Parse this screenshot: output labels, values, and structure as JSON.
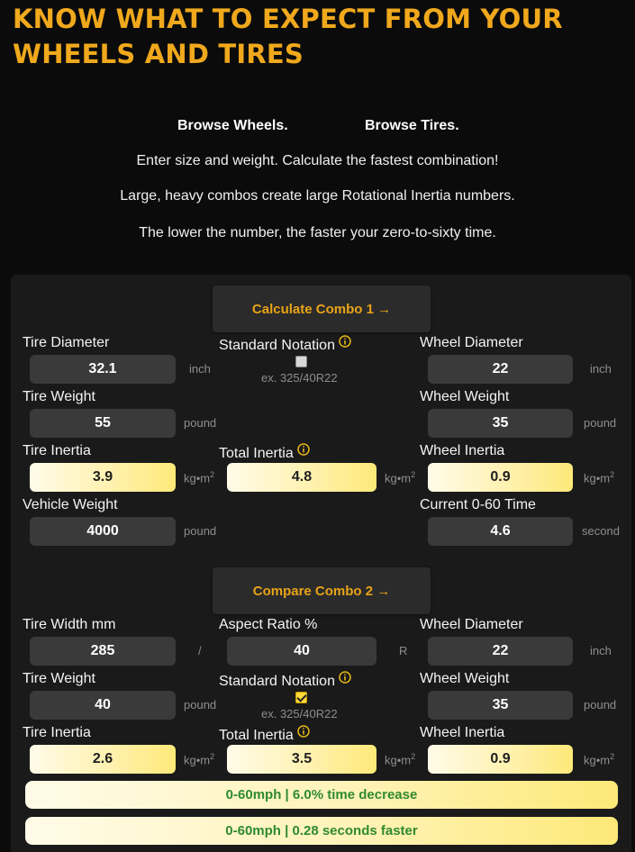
{
  "header": {
    "title_line1": "KNOW WHAT TO EXPECT FROM YOUR",
    "title_line2": "WHEELS AND TIRES",
    "browse_wheels": "Browse Wheels.",
    "browse_tires": "Browse Tires.",
    "intro1": "Enter size and weight. Calculate the fastest combination!",
    "intro2": "Large, heavy combos create large Rotational Inertia numbers.",
    "intro3": "The lower the number, the faster your zero-to-sixty time."
  },
  "combo1": {
    "button": "Calculate Combo 1 →",
    "tire_diameter": {
      "label": "Tire Diameter",
      "value": "32.1",
      "unit": "inch"
    },
    "standard_notation": {
      "label": "Standard Notation",
      "checked": false,
      "hint": "ex. 325/40R22"
    },
    "wheel_diameter": {
      "label": "Wheel Diameter",
      "value": "22",
      "unit": "inch"
    },
    "tire_weight": {
      "label": "Tire Weight",
      "value": "55",
      "unit": "pound"
    },
    "wheel_weight": {
      "label": "Wheel Weight",
      "value": "35",
      "unit": "pound"
    },
    "tire_inertia": {
      "label": "Tire Inertia",
      "value": "3.9",
      "unit": "kg•m"
    },
    "total_inertia": {
      "label": "Total Inertia",
      "value": "4.8",
      "unit": "kg•m"
    },
    "wheel_inertia": {
      "label": "Wheel Inertia",
      "value": "0.9",
      "unit": "kg•m"
    },
    "vehicle_weight": {
      "label": "Vehicle Weight",
      "value": "4000",
      "unit": "pound"
    },
    "current_time": {
      "label": "Current 0-60 Time",
      "value": "4.6",
      "unit": "second"
    }
  },
  "combo2": {
    "button": "Compare Combo 2 →",
    "tire_width": {
      "label": "Tire Width mm",
      "value": "285",
      "sep": "/"
    },
    "aspect_ratio": {
      "label": "Aspect Ratio %",
      "value": "40",
      "sep": "R"
    },
    "wheel_diameter": {
      "label": "Wheel Diameter",
      "value": "22",
      "unit": "inch"
    },
    "tire_weight": {
      "label": "Tire Weight",
      "value": "40",
      "unit": "pound"
    },
    "standard_notation": {
      "label": "Standard Notation",
      "checked": true,
      "hint": "ex. 325/40R22"
    },
    "wheel_weight": {
      "label": "Wheel Weight",
      "value": "35",
      "unit": "pound"
    },
    "tire_inertia": {
      "label": "Tire Inertia",
      "value": "2.6",
      "unit": "kg•m"
    },
    "total_inertia": {
      "label": "Total Inertia",
      "value": "3.5",
      "unit": "kg•m"
    },
    "wheel_inertia": {
      "label": "Wheel Inertia",
      "value": "0.9",
      "unit": "kg•m"
    }
  },
  "results": {
    "percent": "0-60mph | 6.0%  time decrease",
    "seconds": "0-60mph | 0.28 seconds faster"
  },
  "unit_sup": "2",
  "icons": {
    "info": "info-circle-icon",
    "arrow": "arrow-right-icon"
  },
  "colors": {
    "accent": "#e8a317",
    "result_text": "#2f8a2f",
    "field_bg": "#3a3a3a",
    "panel_bg": "#1a1a1a"
  }
}
